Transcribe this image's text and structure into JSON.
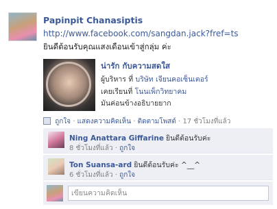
{
  "post": {
    "author": "Papinpit Chanasiptis",
    "url": "http://www.facebook.com/sangdan.jack?fref=ts",
    "message": "ยินดีต้อนรับคุณแสงเดือนเข้าสู่กลุ่ม ค่ะ"
  },
  "share": {
    "title": "น่ารัก กับความสดใส",
    "line1_prefix": "ผู้บริหาร ที่",
    "line1_link": "บริษัท เจียนคอเซ็นเตอร์",
    "line2_prefix": "เคยเรียนที่",
    "line2_link": "โนนเพ็กวิทยาคม",
    "line3": "มันค่อนข้างอธิบายยาก"
  },
  "actions": {
    "like": "ถูกใจ",
    "comment": "แสดงความคิดเห็น",
    "follow": "ติดตามโพสต์",
    "time": "17 ชั่วโมงที่แล้ว",
    "sep": "·"
  },
  "comments": [
    {
      "name": "Ning Anattara Giffarine",
      "text": "ยินดีต้อนรับค่ะ",
      "time": "8 ชั่วโมงที่แล้ว",
      "like": "ถูกใจ"
    },
    {
      "name": "Ton Suansa-ard",
      "text": "ยินดีต้อนรับค่ะ ^__^",
      "time": "6 ชั่วโมงที่แล้ว",
      "like": "ถูกใจ"
    }
  ],
  "composer": {
    "placeholder": "เขียนความคิดเห็น"
  },
  "icons": {
    "share_action": "share-icon"
  },
  "colors": {
    "link": "#3b5998",
    "comment_bg": "#edeff4",
    "meta": "#808080"
  }
}
